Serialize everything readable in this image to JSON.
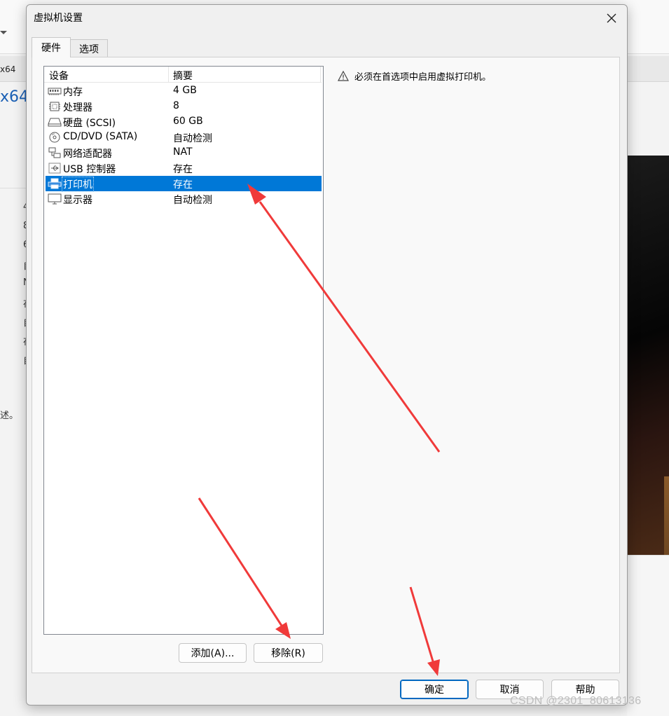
{
  "background": {
    "tab_text": "x64",
    "title_fragment": "x64",
    "letters": [
      "4",
      "8",
      "6",
      "自",
      "N",
      "存",
      "自",
      "存",
      "自"
    ],
    "desc_fragment": "述。"
  },
  "dialog": {
    "title": "虚拟机设置",
    "tabs": [
      {
        "label": "硬件",
        "active": true
      },
      {
        "label": "选项",
        "active": false
      }
    ],
    "list": {
      "columns": [
        "设备",
        "摘要"
      ],
      "rows": [
        {
          "icon": "memory-icon",
          "name": "内存",
          "summary": "4 GB"
        },
        {
          "icon": "processor-icon",
          "name": "处理器",
          "summary": "8"
        },
        {
          "icon": "hard-disk-icon",
          "name": "硬盘 (SCSI)",
          "summary": "60 GB"
        },
        {
          "icon": "cd-dvd-icon",
          "name": "CD/DVD (SATA)",
          "summary": "自动检测"
        },
        {
          "icon": "network-adapter-icon",
          "name": "网络适配器",
          "summary": "NAT"
        },
        {
          "icon": "usb-icon",
          "name": "USB 控制器",
          "summary": "存在"
        },
        {
          "icon": "printer-icon",
          "name": "打印机",
          "summary": "存在",
          "selected": true
        },
        {
          "icon": "display-icon",
          "name": "显示器",
          "summary": "自动检测"
        }
      ]
    },
    "add_button": "添加(A)...",
    "remove_button": "移除(R)",
    "notice": "必须在首选项中启用虚拟打印机。",
    "ok_button": "确定",
    "cancel_button": "取消",
    "help_button": "帮助"
  },
  "watermark": "CSDN @2301_80613136",
  "colors": {
    "selection": "#0078d7",
    "annotation_arrow": "#f03a3a",
    "default_button_border": "#0067c0"
  }
}
